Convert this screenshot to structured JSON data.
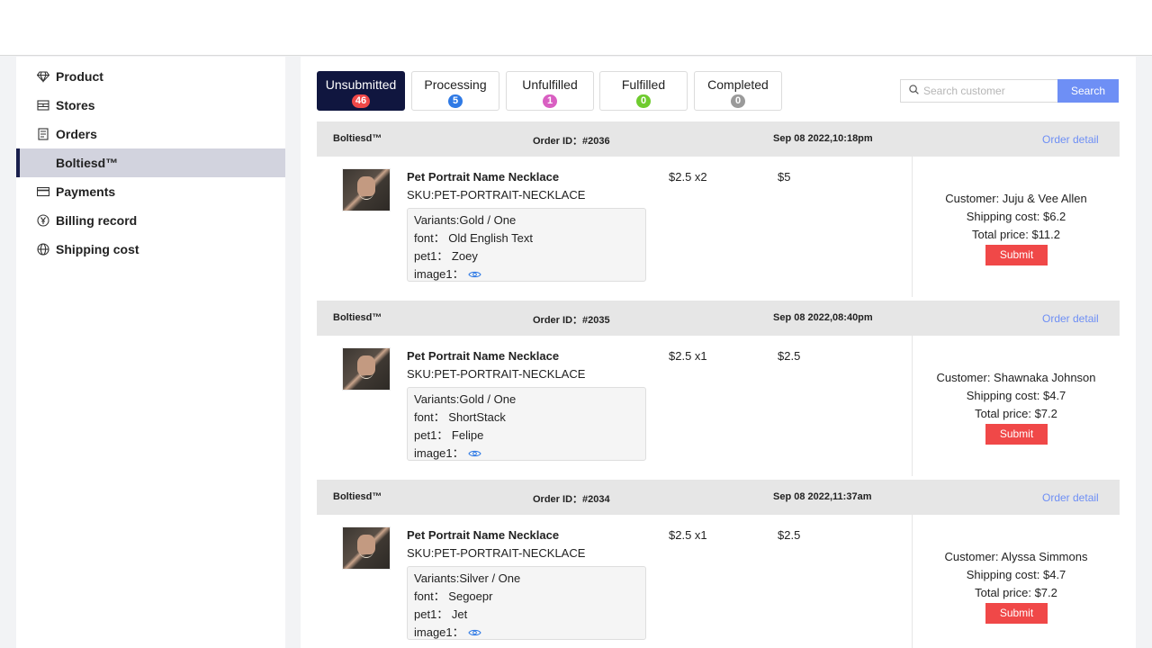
{
  "sidebar": {
    "items": [
      {
        "label": "Product",
        "icon": "diamond-icon"
      },
      {
        "label": "Stores",
        "icon": "store-icon"
      },
      {
        "label": "Orders",
        "icon": "orders-icon"
      },
      {
        "label": "Boltiesd™",
        "icon": ""
      },
      {
        "label": "Payments",
        "icon": "card-icon"
      },
      {
        "label": "Billing record",
        "icon": "yen-icon"
      },
      {
        "label": "Shipping cost",
        "icon": "globe-icon"
      }
    ]
  },
  "tabs": [
    {
      "label": "Unsubmitted",
      "count": "46",
      "color": "#f04848"
    },
    {
      "label": "Processing",
      "count": "5",
      "color": "#2f7ae5"
    },
    {
      "label": "Unfulfilled",
      "count": "1",
      "color": "#d95fc2"
    },
    {
      "label": "Fulfilled",
      "count": "0",
      "color": "#6fcb2f"
    },
    {
      "label": "Completed",
      "count": "0",
      "color": "#9a9a9a"
    }
  ],
  "search": {
    "placeholder": "Search customer",
    "value": "",
    "button": "Search"
  },
  "orders": [
    {
      "store": "Boltiesd™",
      "order_id": "Order ID：#2036",
      "date": "Sep 08 2022,10:18pm",
      "detail_link": "Order detail",
      "product": "Pet Portrait Name Necklace",
      "sku": "SKU:PET-PORTRAIT-NECKLACE",
      "variant": "Variants:Gold / One",
      "font": "font：  Old English Text",
      "pet": "pet1：  Zoey",
      "image": "image1：",
      "price": "$2.5  x2",
      "line_total": "$5",
      "customer": "Customer: Juju & Vee Allen",
      "shipping": "Shipping cost: $6.2",
      "total": "Total price: $11.2",
      "submit": "Submit"
    },
    {
      "store": "Boltiesd™",
      "order_id": "Order ID：#2035",
      "date": "Sep 08 2022,08:40pm",
      "detail_link": "Order detail",
      "product": "Pet Portrait Name Necklace",
      "sku": "SKU:PET-PORTRAIT-NECKLACE",
      "variant": "Variants:Gold / One",
      "font": "font：  ShortStack",
      "pet": "pet1：  Felipe",
      "image": "image1：",
      "price": "$2.5  x1",
      "line_total": "$2.5",
      "customer": "Customer: Shawnaka Johnson",
      "shipping": "Shipping cost: $4.7",
      "total": "Total price: $7.2",
      "submit": "Submit"
    },
    {
      "store": "Boltiesd™",
      "order_id": "Order ID：#2034",
      "date": "Sep 08 2022,11:37am",
      "detail_link": "Order detail",
      "product": "Pet Portrait Name Necklace",
      "sku": "SKU:PET-PORTRAIT-NECKLACE",
      "variant": "Variants:Silver / One",
      "font": "font：  Segoepr",
      "pet": "pet1：  Jet",
      "image": "image1：",
      "price": "$2.5  x1",
      "line_total": "$2.5",
      "customer": "Customer: Alyssa Simmons",
      "shipping": "Shipping cost: $4.7",
      "total": "Total price: $7.2",
      "submit": "Submit"
    }
  ]
}
